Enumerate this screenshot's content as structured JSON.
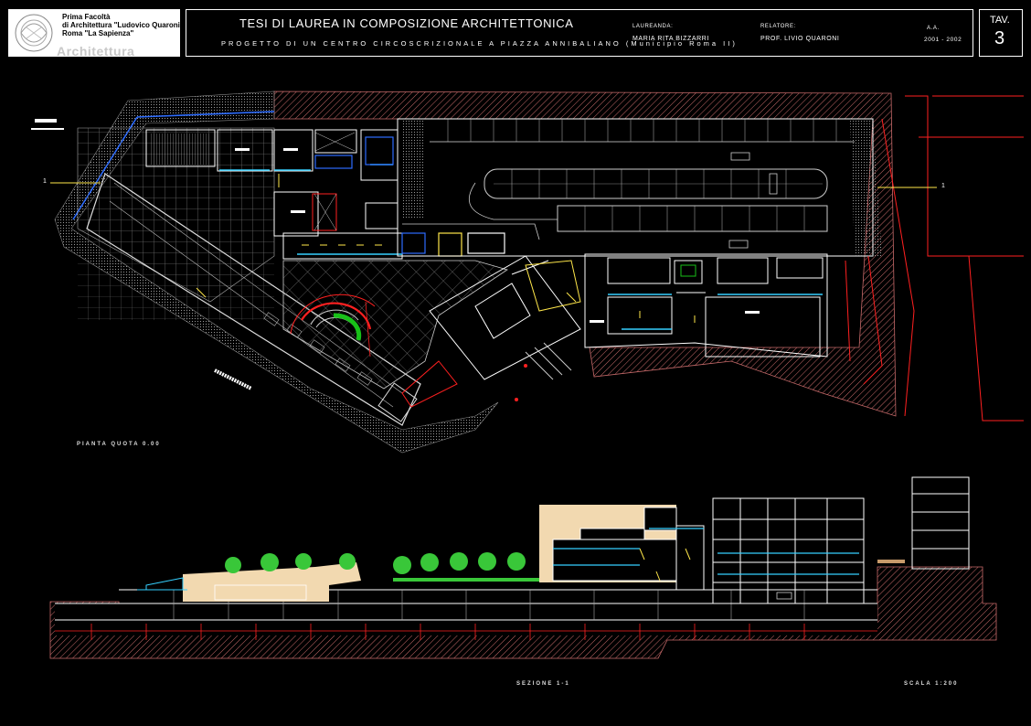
{
  "logo": {
    "lines": [
      "Prima Facoltà",
      "di Architettura \"Ludovico Quaroni\"",
      "Roma \"La Sapienza\""
    ],
    "word": "Architettura"
  },
  "title": {
    "main": "TESI DI LAUREA IN COMPOSIZIONE ARCHITETTONICA",
    "sub": "PROGETTO DI UN CENTRO CIRCOSCRIZIONALE A PIAZZA ANNIBALIANO (Municipio Roma II)"
  },
  "laureanda": {
    "label": "LAUREANDA:",
    "name": "MARIA RITA BIZZARRI"
  },
  "relatore": {
    "label": "RELATORE:",
    "name": "PROF. LIVIO QUARONI"
  },
  "anno": {
    "label": "A.A.",
    "value": "2001 - 2002"
  },
  "tavola": {
    "label": "TAV.",
    "number": "3"
  },
  "drawing": {
    "plan_label": "PIANTA QUOTA 0.00",
    "section_label": "SEZIONE 1-1",
    "scale_label": "SCALA 1:200",
    "section_marker": "1"
  },
  "colors": {
    "background": "#000000",
    "wall": "#ffffff",
    "hatch": "#c76a6a",
    "red": "#ff2020",
    "blue": "#2d6cff",
    "cyan": "#35d0ff",
    "yellow": "#ffe74a",
    "green": "#18c018",
    "tan": "#f2d9b0",
    "tree": "#39c739",
    "grid": "#7a7a7a"
  }
}
